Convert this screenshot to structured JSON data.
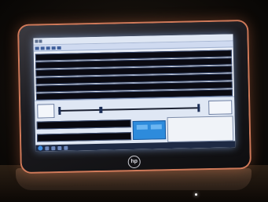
{
  "scene": {
    "description_colors": {
      "screen_glow": "#e9eef7",
      "bezel_accent": "#d07a5a",
      "taskbar": "#1e2a44",
      "highlight_box": "#2d8bdc"
    }
  },
  "logo": {
    "brand": "hp"
  }
}
